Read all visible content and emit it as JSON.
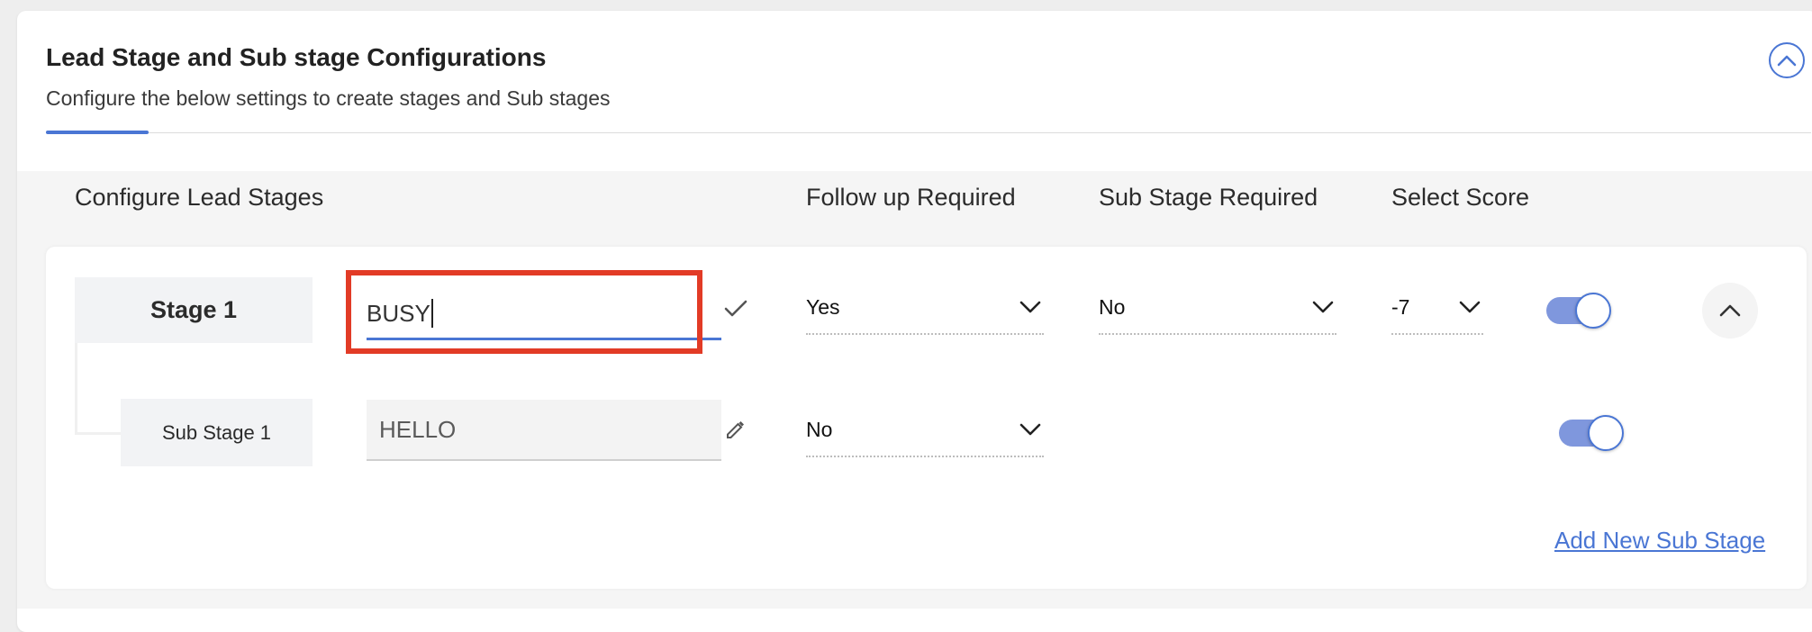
{
  "header": {
    "title": "Lead Stage and Sub stage Configurations",
    "subtitle": "Configure the below settings to create stages and Sub stages"
  },
  "columns": {
    "configure": "Configure Lead Stages",
    "follow_up": "Follow up Required",
    "sub_stage": "Sub Stage Required",
    "score": "Select Score"
  },
  "stage": {
    "label": "Stage 1",
    "name_value": "BUSY",
    "follow_up": "Yes",
    "sub_stage_required": "No",
    "score": "-7",
    "enabled": true
  },
  "sub_stage": {
    "label": "Sub Stage 1",
    "name_value": "HELLO",
    "follow_up": "No",
    "enabled": true
  },
  "actions": {
    "add_sub_stage": "Add New Sub Stage"
  },
  "colors": {
    "accent": "#4a76d4",
    "highlight": "#e23b26",
    "toggle_track": "#7f97dd"
  },
  "icons": {
    "collapse": "chevron-up-circle-icon",
    "confirm": "check-icon",
    "edit": "pencil-icon",
    "dropdown": "chevron-down-icon",
    "expand": "chevron-up-icon"
  }
}
